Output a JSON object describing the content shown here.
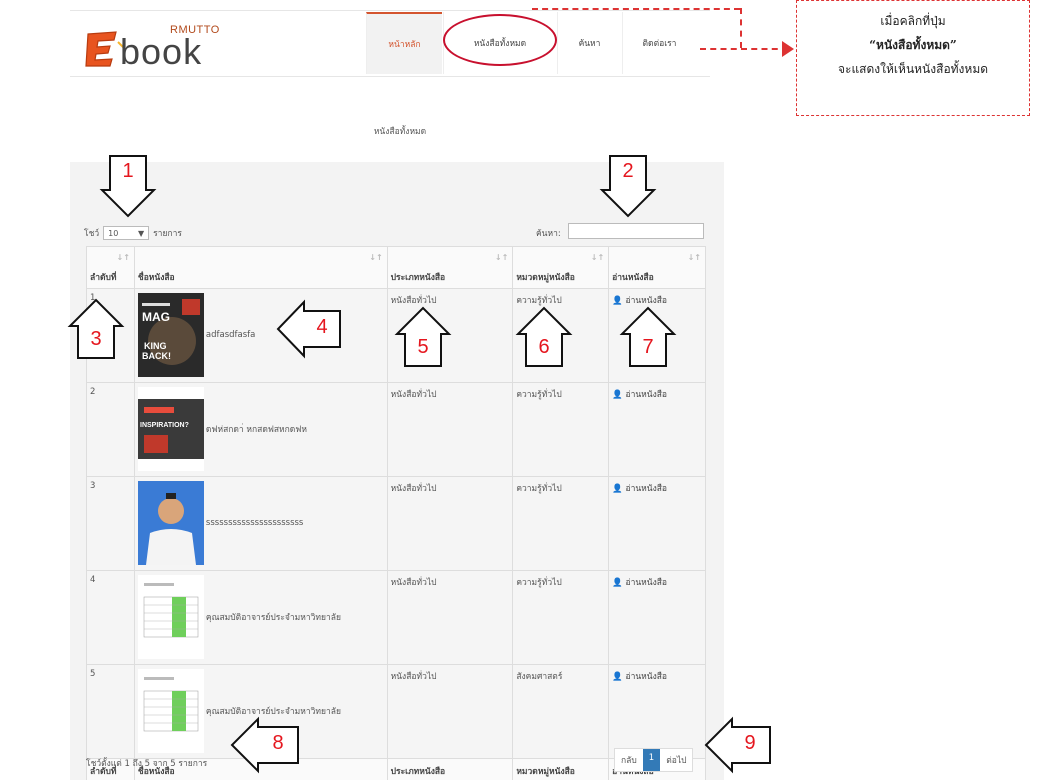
{
  "header": {
    "logo_small": "RMUTTO",
    "logo_word": "book",
    "nav": [
      {
        "label": "หน้าหลัก",
        "active": true
      },
      {
        "label": "หนังสือทั้งหมด",
        "active": false
      },
      {
        "label": "ค้นหา",
        "active": false
      },
      {
        "label": "ติดต่อเรา",
        "active": false
      }
    ]
  },
  "callout": {
    "line1": "เมื่อคลิกที่ปุ่ม",
    "line2": "“หนังสือทั้งหมด”",
    "line3": "จะแสดงให้เห็นหนังสือทั้งหมด"
  },
  "page_title": "หนังสือทั้งหมด",
  "controls": {
    "show_label": "โชว์",
    "length_value": "10",
    "entries_label": "รายการ",
    "search_label": "ค้นหา:"
  },
  "table": {
    "headers": [
      "ลำดับที่",
      "ชื่อหนังสือ",
      "ประเภทหนังสือ",
      "หมวดหมู่หนังสือ",
      "อ่านหนังสือ"
    ],
    "footers": [
      "ลำดับที่",
      "ชื่อหนังสือ",
      "ประเภทหนังสือ",
      "หมวดหมู่หนังสือ",
      "อ่านหนังสือ"
    ],
    "rows": [
      {
        "no": "1",
        "title": "adfasdfasfa",
        "type": "หนังสือทั่วไป",
        "category": "ความรู้ทั่วไป",
        "read": "อ่านหนังสือ"
      },
      {
        "no": "2",
        "title": "ดฟห่สกดา่ หกสดฟสหกดฟห",
        "type": "หนังสือทั่วไป",
        "category": "ความรู้ทั่วไป",
        "read": "อ่านหนังสือ"
      },
      {
        "no": "3",
        "title": "ssssssssssssssssssssss",
        "type": "หนังสือทั่วไป",
        "category": "ความรู้ทั่วไป",
        "read": "อ่านหนังสือ"
      },
      {
        "no": "4",
        "title": "คุณสมบัติอาจารย์ประจำมหาวิทยาลัย",
        "type": "หนังสือทั่วไป",
        "category": "ความรู้ทั่วไป",
        "read": "อ่านหนังสือ"
      },
      {
        "no": "5",
        "title": "คุณสมบัติอาจารย์ประจำมหาวิทยาลัย",
        "type": "หนังสือทั่วไป",
        "category": "สังคมศาสตร์",
        "read": "อ่านหนังสือ"
      }
    ]
  },
  "footer": {
    "info": "โชว์ตั้งแต่ 1 ถึง 5 จาก 5 รายการ",
    "prev": "กลับ",
    "page": "1",
    "next": "ต่อไป"
  },
  "cover1_text": {
    "a": "MAG",
    "b": "KING",
    "c": "BACK!"
  },
  "cover2_text": {
    "a": "INSPIRATION?"
  },
  "markers": [
    "1",
    "2",
    "3",
    "4",
    "5",
    "6",
    "7",
    "8",
    "9"
  ],
  "colors": {
    "accent": "#d4552f",
    "annotation": "#e5161e",
    "page_active": "#337ab7"
  }
}
